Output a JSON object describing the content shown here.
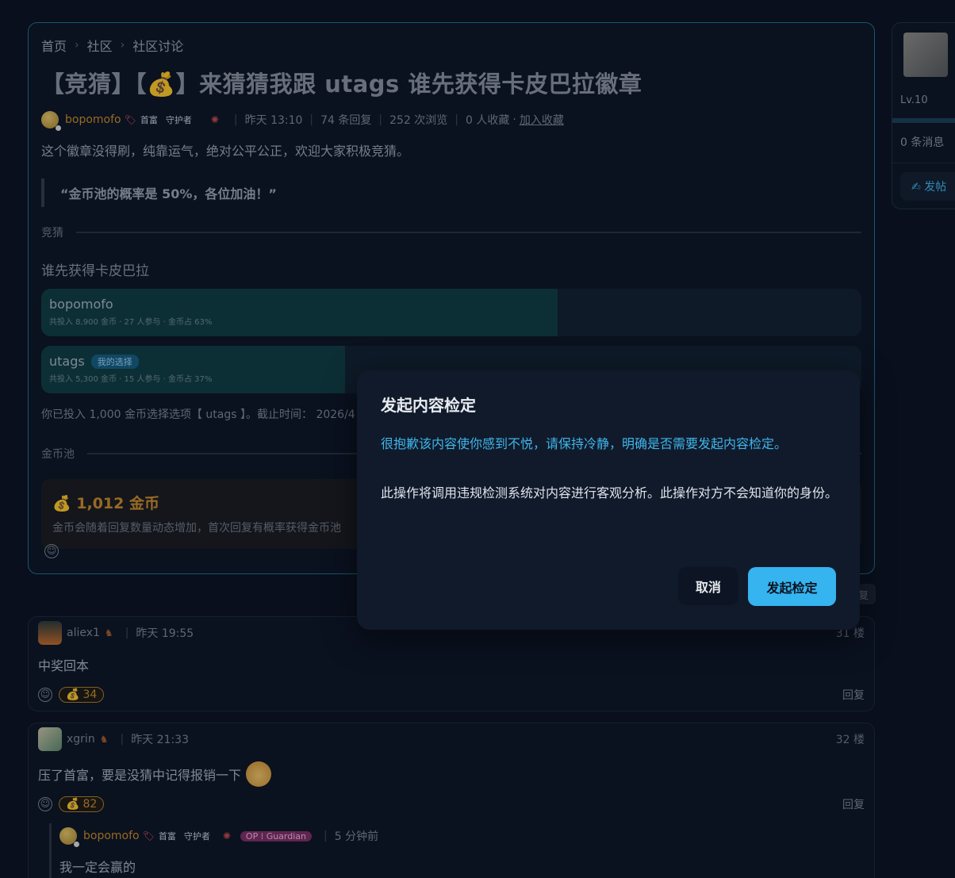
{
  "breadcrumb": [
    "首页",
    "社区",
    "社区讨论"
  ],
  "post": {
    "title": "【竞猜】【💰】来猜猜我跟 utags 谁先获得卡皮巴拉徽章",
    "author": "bopomofo",
    "badges": [
      "首富",
      "守护者"
    ],
    "time": "昨天 13:10",
    "replies": "74 条回复",
    "views": "252 次浏览",
    "favorites": "0 人收藏",
    "add_favorite": "加入收藏",
    "body": "这个徽章没得刷，纯靠运气，绝对公平公正，欢迎大家积极竞猜。",
    "quote": "“金币池的概率是 50%，各位加油！”"
  },
  "guess": {
    "section_label": "竞猜",
    "question": "谁先获得卡皮巴拉",
    "options": [
      {
        "name": "bopomofo",
        "sub": "共投入 8,900 金币 · 27 人参与 · 金币占 63%",
        "share": 63,
        "chosen_badge": ""
      },
      {
        "name": "utags",
        "sub": "共投入 5,300 金币 · 15 人参与 · 金币占 37%",
        "share": 37,
        "chosen_badge": "我的选择"
      }
    ],
    "invest_note": "你已投入 1,000 金币选择选项【 utags 】。截止时间： 2026/4"
  },
  "pool": {
    "section_label": "金币池",
    "amount": "💰 1,012 金币",
    "note": "金币会随着回复数量动态增加，首次回复有概率获得金币池"
  },
  "sidebar": {
    "level": "Lv.10",
    "messages": "0 条消息",
    "post_button": "✍ 发帖"
  },
  "behind_reply": "复",
  "comments": [
    {
      "user": "aliex1",
      "time": "昨天 19:55",
      "floor": "31 楼",
      "body": "中奖回本",
      "coins": "34",
      "reply": "回复"
    },
    {
      "user": "xgrin",
      "time": "昨天 21:33",
      "floor": "32 楼",
      "body": "压了首富，要是没猜中记得报销一下",
      "coins": "82",
      "reply": "回复"
    }
  ],
  "nested_reply": {
    "user": "bopomofo",
    "badges": [
      "首富",
      "守护者"
    ],
    "op_badge": "OP ⁞ Guardian",
    "time": "5 分钟前",
    "body": "我一定会赢的"
  },
  "dialog": {
    "title": "发起内容检定",
    "warning": "很抱歉该内容使你感到不悦，请保持冷静，明确是否需要发起内容检定。",
    "description": "此操作将调用违规检测系统对内容进行客观分析。此操作对方不会知道你的身份。",
    "cancel": "取消",
    "confirm": "发起检定"
  },
  "colors": {
    "accent": "#35b4ef",
    "gold": "#c98b2b",
    "fill": "#0f3d42"
  }
}
